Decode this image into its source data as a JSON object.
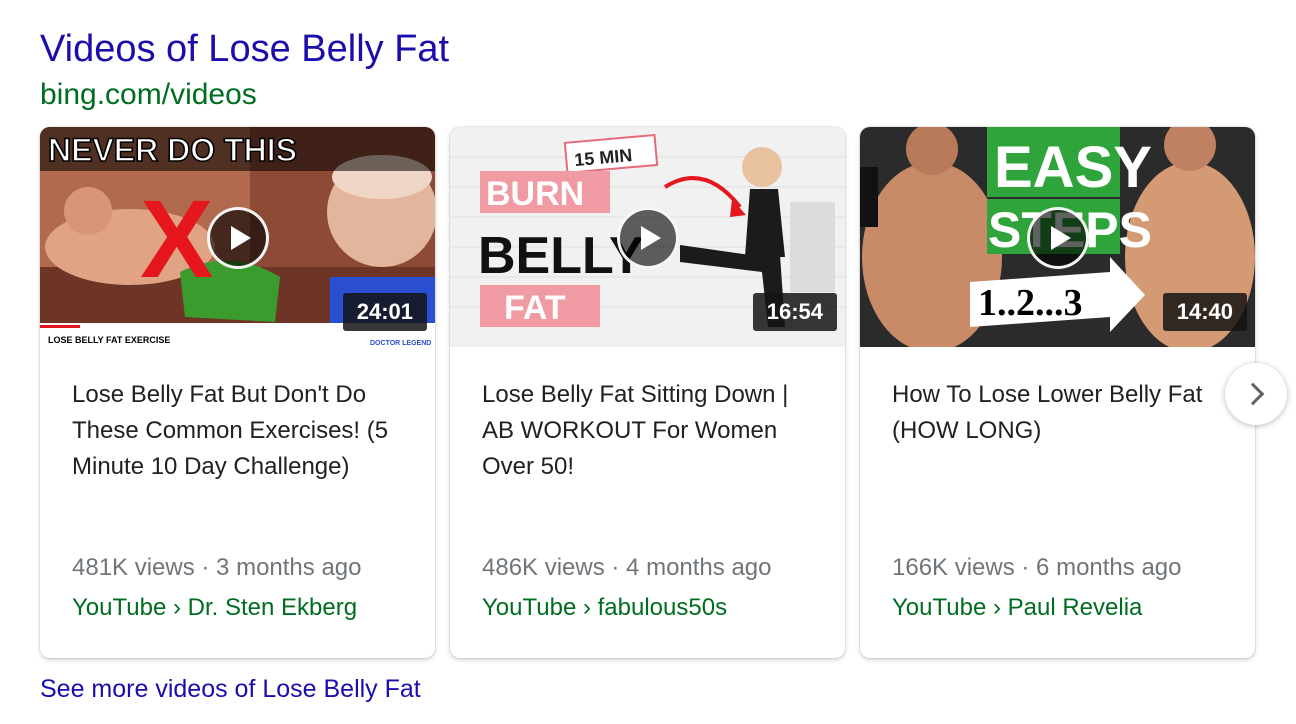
{
  "header": {
    "title": "Videos of Lose Belly Fat",
    "source": "bing.com/videos"
  },
  "cards": [
    {
      "title": "Lose Belly Fat But Don't Do These Common Exercises! (5 Minute 10 Day Challenge)",
      "duration": "24:01",
      "meta": "481K views · 3 months ago",
      "channel": "YouTube › Dr. Sten Ekberg",
      "thumb": {
        "banner": "NEVER DO THIS",
        "mark": "X",
        "footer": "LOSE BELLY FAT EXERCISE",
        "corner": "DOCTOR LEGEND"
      }
    },
    {
      "title": "Lose Belly Fat Sitting Down | AB WORKOUT For Women Over 50!",
      "duration": "16:54",
      "meta": "486K views · 4 months ago",
      "channel": "YouTube › fabulous50s",
      "thumb": {
        "tag": "15 MIN",
        "line1": "BURN",
        "line2": "BELLY",
        "line3": "FAT"
      }
    },
    {
      "title": "How To Lose Lower Belly Fat (HOW LONG)",
      "duration": "14:40",
      "meta": "166K views · 6 months ago",
      "channel": "YouTube › Paul Revelia",
      "thumb": {
        "line1": "EASY",
        "line2": "STEPS",
        "arrow_text": "1..2...3"
      }
    }
  ],
  "icons": {
    "play": "play-icon",
    "next": "chevron-right-icon"
  },
  "see_more": "See more videos of Lose Belly Fat",
  "colors": {
    "link": "#1a0dab",
    "source_green": "#006d21",
    "meta_gray": "#70757a",
    "text": "#202124"
  }
}
